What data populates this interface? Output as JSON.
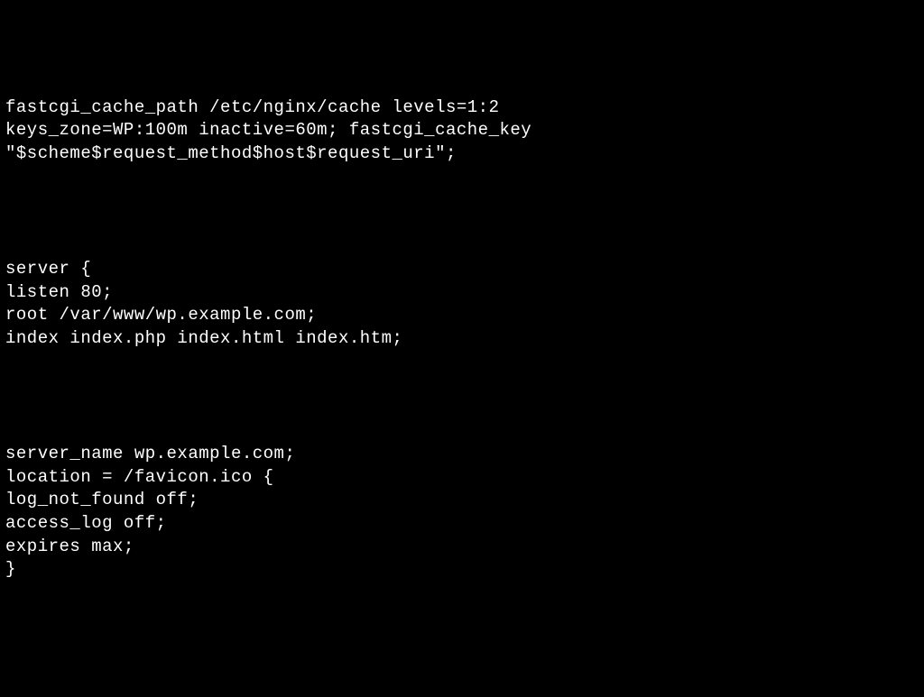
{
  "config": {
    "lines": [
      "fastcgi_cache_path /etc/nginx/cache levels=1:2",
      "keys_zone=WP:100m inactive=60m; fastcgi_cache_key",
      "\"$scheme$request_method$host$request_uri\";",
      "",
      "",
      "",
      "",
      "server {",
      "listen 80;",
      "root /var/www/wp.example.com;",
      "index index.php index.html index.htm;",
      "",
      "",
      "",
      "",
      "server_name wp.example.com;",
      "location = /favicon.ico {",
      "log_not_found off;",
      "access_log off;",
      "expires max;",
      "}"
    ]
  }
}
